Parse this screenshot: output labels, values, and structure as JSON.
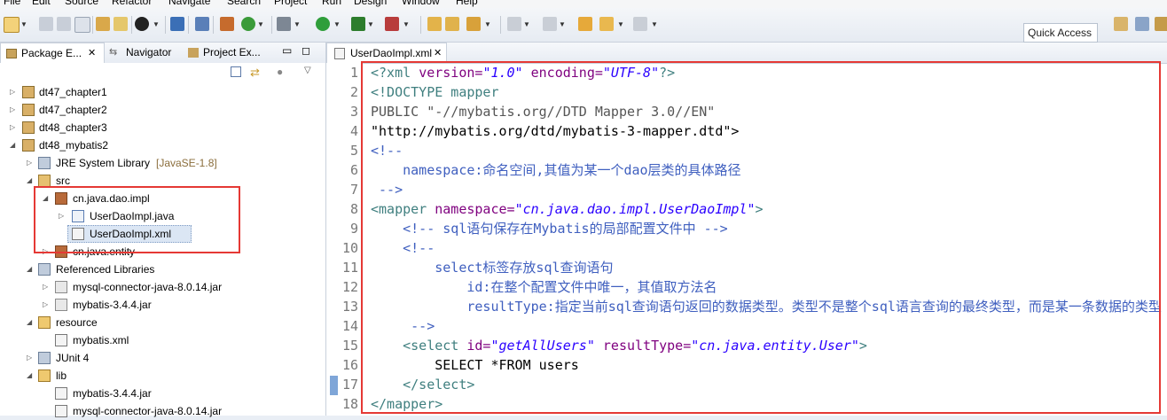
{
  "menubar": [
    "File",
    "Edit",
    "Source",
    "Refactor",
    "Navigate",
    "Search",
    "Project",
    "Run",
    "Design",
    "Window",
    "Help"
  ],
  "quick_access": "Quick Access",
  "left_tabs": [
    "Package E...",
    "Navigator",
    "Project Ex..."
  ],
  "tree": [
    {
      "label": "dt47_chapter1",
      "icon": "project-icon"
    },
    {
      "label": "dt47_chapter2",
      "icon": "project-icon"
    },
    {
      "label": "dt48_chapter3",
      "icon": "project-icon"
    },
    {
      "label": "dt48_mybatis2",
      "icon": "project-icon"
    },
    {
      "label": "JRE System Library",
      "suffix": "[JavaSE-1.8]",
      "icon": "library-icon"
    },
    {
      "label": "src",
      "icon": "source-folder-icon"
    },
    {
      "label": "cn.java.dao.impl",
      "icon": "package-icon"
    },
    {
      "label": "UserDaoImpl.java",
      "icon": "java-file-icon"
    },
    {
      "label": "UserDaoImpl.xml",
      "icon": "xml-file-icon"
    },
    {
      "label": "cn.java.entity",
      "icon": "package-icon"
    },
    {
      "label": "Referenced Libraries",
      "icon": "library-icon"
    },
    {
      "label": "mysql-connector-java-8.0.14.jar",
      "icon": "jar-icon"
    },
    {
      "label": "mybatis-3.4.4.jar",
      "icon": "jar-icon"
    },
    {
      "label": "resource",
      "icon": "folder-icon"
    },
    {
      "label": "mybatis.xml",
      "icon": "xml-file-icon"
    },
    {
      "label": "JUnit 4",
      "icon": "library-icon"
    },
    {
      "label": "lib",
      "icon": "folder-icon"
    },
    {
      "label": "mybatis-3.4.4.jar",
      "icon": "jar-icon"
    },
    {
      "label": "mysql-connector-java-8.0.14.jar",
      "icon": "jar-icon"
    }
  ],
  "editor_tab": "UserDaoImpl.xml",
  "line_numbers": [
    "1",
    "2",
    "3",
    "4",
    "5",
    "6",
    "7",
    "8",
    "9",
    "10",
    "11",
    "12",
    "13",
    "14",
    "15",
    "16",
    "17",
    "18"
  ],
  "code": {
    "l1": [
      "<?xml ",
      "version=",
      "\"1.0\"",
      " encoding=",
      "\"UTF-8\"",
      "?>"
    ],
    "l2": "<!DOCTYPE mapper",
    "l3": "PUBLIC \"-//mybatis.org//DTD Mapper 3.0//EN\"",
    "l4": "\"http://mybatis.org/dtd/mybatis-3-mapper.dtd\">",
    "l5": "<!--",
    "l6": "    namespace:命名空间,其值为某一个dao层类的具体路径",
    "l7": " -->",
    "l8": [
      "<mapper ",
      "namespace=",
      "\"cn.java.dao.impl.UserDaoImpl\"",
      ">"
    ],
    "l9": "    <!-- sql语句保存在Mybatis的局部配置文件中 -->",
    "l10": "    <!--",
    "l11": "        select标签存放sql查询语句",
    "l12": "            id:在整个配置文件中唯一，其值取方法名",
    "l13": "            resultType:指定当前sql查询语句返回的数据类型。类型不是整个sql语言查询的最终类型，而是某一条数据的类型",
    "l14": "     -->",
    "l15": [
      "    <select ",
      "id=",
      "\"getAllUsers\"",
      " resultType=",
      "\"cn.java.entity.User\"",
      ">"
    ],
    "l16": "        SELECT *FROM users",
    "l17": "    </select>",
    "l18": "</mapper>"
  },
  "colors": {
    "highlight": "#e53935",
    "tag": "#3f7f7f",
    "attr": "#7f007f",
    "value": "#2a00ff",
    "comment": "#3f5fbf"
  }
}
